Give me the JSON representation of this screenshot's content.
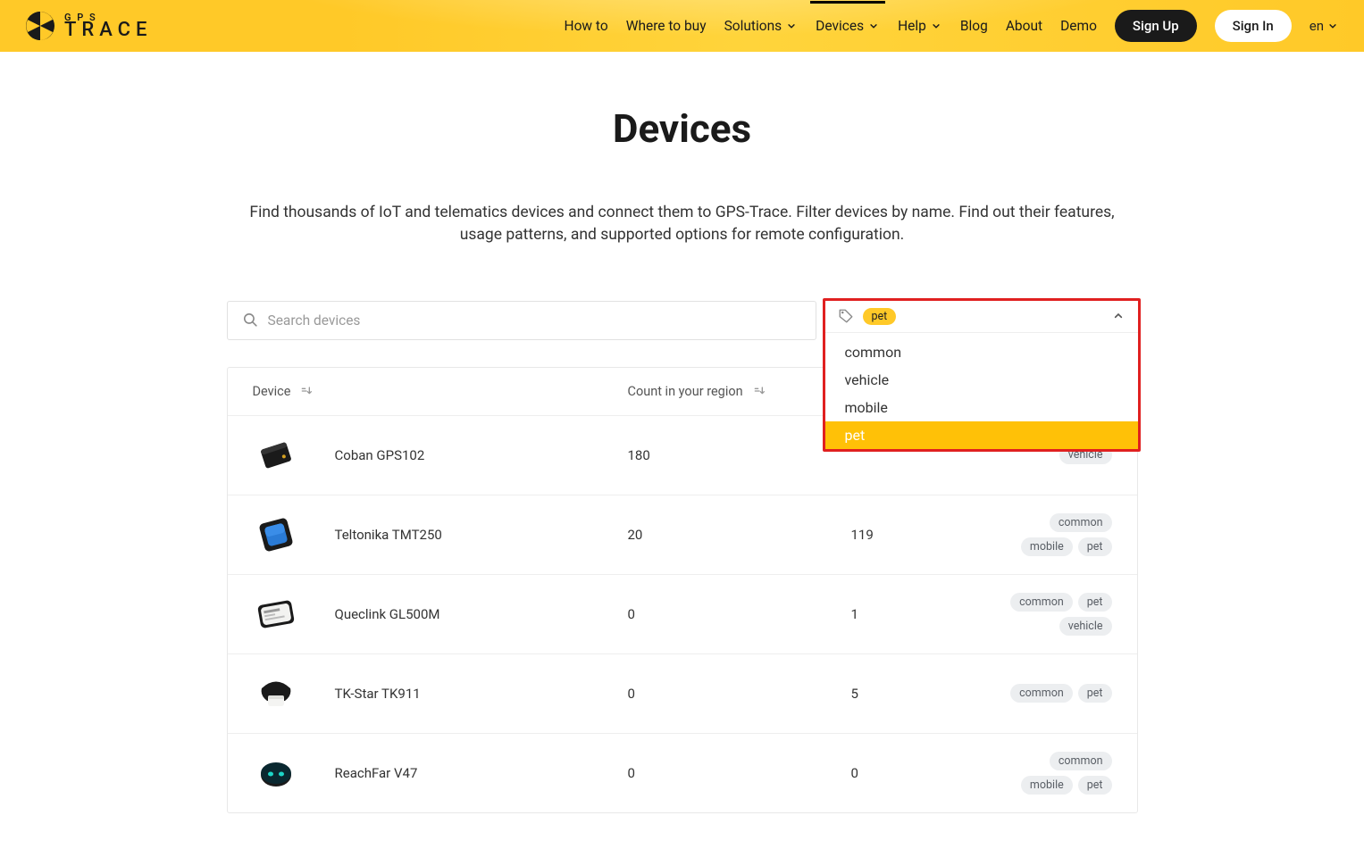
{
  "brand": {
    "small": "G P S",
    "big": "TRACE"
  },
  "nav": {
    "howto": "How to",
    "where": "Where to buy",
    "solutions": "Solutions",
    "devices": "Devices",
    "help": "Help",
    "blog": "Blog",
    "about": "About",
    "demo": "Demo"
  },
  "buttons": {
    "signup": "Sign Up",
    "signin": "Sign In"
  },
  "lang": "en",
  "title": "Devices",
  "subtitle": "Find thousands of IoT and telematics devices and connect them to GPS-Trace. Filter devices by name. Find out their features, usage patterns, and supported options for remote configuration.",
  "search": {
    "placeholder": "Search devices"
  },
  "filter": {
    "selected": "pet",
    "options": [
      "common",
      "vehicle",
      "mobile",
      "pet"
    ]
  },
  "columns": {
    "device": "Device",
    "count": "Count in your region"
  },
  "rows": [
    {
      "name": "Coban GPS102",
      "count": "180",
      "port": "",
      "tags": [
        "vehicle"
      ],
      "thumb": "black-box"
    },
    {
      "name": "Teltonika TMT250",
      "count": "20",
      "port": "119",
      "tags": [
        "common",
        "mobile",
        "pet"
      ],
      "thumb": "blue-square"
    },
    {
      "name": "Queclink GL500M",
      "count": "0",
      "port": "1",
      "tags": [
        "common",
        "pet",
        "vehicle"
      ],
      "thumb": "white-label"
    },
    {
      "name": "TK-Star TK911",
      "count": "0",
      "port": "5",
      "tags": [
        "common",
        "pet"
      ],
      "thumb": "collar"
    },
    {
      "name": "ReachFar V47",
      "count": "0",
      "port": "0",
      "tags": [
        "common",
        "mobile",
        "pet"
      ],
      "thumb": "round-teal"
    }
  ]
}
